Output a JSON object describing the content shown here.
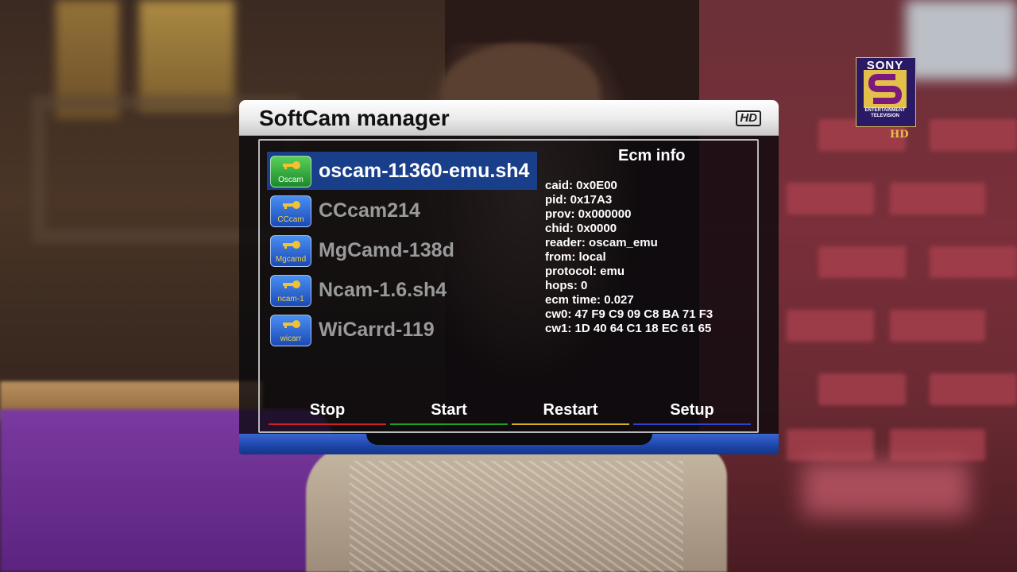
{
  "dialog": {
    "title": "SoftCam manager",
    "hd_badge": "HD"
  },
  "channel_logo": {
    "brand": "SONY",
    "subtitle": "ENTERTAINMENT TELEVISION",
    "hd": "HD"
  },
  "softcams": [
    {
      "name": "oscam-11360-emu.sh4",
      "icon_label": "Oscam",
      "icon": "key-icon",
      "icon_color": "#2aa83a",
      "selected": true
    },
    {
      "name": "CCcam214",
      "icon_label": "CCcam",
      "icon": "key-icon",
      "icon_color": "#2a66d8",
      "selected": false
    },
    {
      "name": "MgCamd-138d",
      "icon_label": "Mgcamd",
      "icon": "key-icon",
      "icon_color": "#2a66d8",
      "selected": false
    },
    {
      "name": "Ncam-1.6.sh4",
      "icon_label": "ncam-1",
      "icon": "key-icon",
      "icon_color": "#2a66d8",
      "selected": false
    },
    {
      "name": "WiCarrd-119",
      "icon_label": "wicarr",
      "icon": "key-icon",
      "icon_color": "#2a66d8",
      "selected": false
    }
  ],
  "ecm_info": {
    "title": "Ecm info",
    "lines": [
      "caid: 0x0E00",
      "pid: 0x17A3",
      "prov: 0x000000",
      "chid: 0x0000",
      "reader: oscam_emu",
      "from: local",
      "protocol: emu",
      "hops: 0",
      "ecm time: 0.027",
      "cw0: 47 F9 C9 09 C8 BA 71 F3",
      "cw1: 1D 40 64 C1 18 EC 61 65"
    ]
  },
  "buttons": [
    {
      "label": "Stop",
      "color": "#d02020"
    },
    {
      "label": "Start",
      "color": "#20a020"
    },
    {
      "label": "Restart",
      "color": "#d0b020"
    },
    {
      "label": "Setup",
      "color": "#3040d0"
    }
  ]
}
